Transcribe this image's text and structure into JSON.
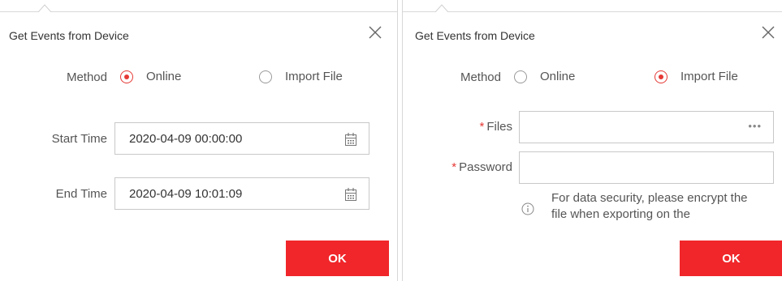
{
  "left_dialog": {
    "title": "Get Events from Device",
    "method_label": "Method",
    "options": [
      {
        "label": "Online",
        "selected": true
      },
      {
        "label": "Import File",
        "selected": false
      }
    ],
    "start_time_label": "Start Time",
    "start_time_value": "2020-04-09 00:00:00",
    "end_time_label": "End Time",
    "end_time_value": "2020-04-09 10:01:09",
    "ok_label": "OK"
  },
  "right_dialog": {
    "title": "Get Events from Device",
    "method_label": "Method",
    "options": [
      {
        "label": "Online",
        "selected": false
      },
      {
        "label": "Import File",
        "selected": true
      }
    ],
    "files_label": "Files",
    "password_label": "Password",
    "required_mark": "*",
    "files_value": "",
    "password_value": "",
    "browse_glyph": "•••",
    "info_text": "For data security, please encrypt the file when exporting on the",
    "ok_label": "OK"
  },
  "colors": {
    "accent": "#e53935",
    "button": "#f0262a"
  },
  "icons": [
    "close-icon",
    "calendar-icon",
    "info-icon",
    "more-icon"
  ]
}
